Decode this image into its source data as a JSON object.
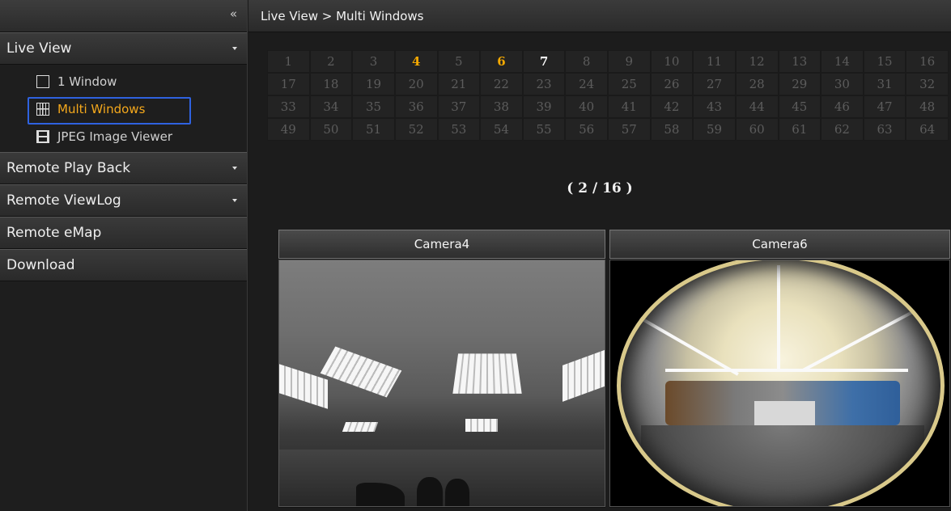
{
  "sidebar": {
    "collapse_icon": "«",
    "menus": [
      {
        "label": "Live View"
      },
      {
        "label": "Remote Play Back"
      },
      {
        "label": "Remote ViewLog"
      },
      {
        "label": "Remote eMap"
      },
      {
        "label": "Download"
      }
    ],
    "live_view_items": [
      {
        "label": "1 Window",
        "icon": "window-icon"
      },
      {
        "label": "Multi Windows",
        "icon": "grid-icon"
      },
      {
        "label": "JPEG Image Viewer",
        "icon": "film-icon"
      }
    ]
  },
  "header": {
    "breadcrumb": "Live View > Multi Windows"
  },
  "channels": {
    "numbers": [
      "1",
      "2",
      "3",
      "4",
      "5",
      "6",
      "7",
      "8",
      "9",
      "10",
      "11",
      "12",
      "13",
      "14",
      "15",
      "16",
      "17",
      "18",
      "19",
      "20",
      "21",
      "22",
      "23",
      "24",
      "25",
      "26",
      "27",
      "28",
      "29",
      "30",
      "31",
      "32",
      "33",
      "34",
      "35",
      "36",
      "37",
      "38",
      "39",
      "40",
      "41",
      "42",
      "43",
      "44",
      "45",
      "46",
      "47",
      "48",
      "49",
      "50",
      "51",
      "52",
      "53",
      "54",
      "55",
      "56",
      "57",
      "58",
      "59",
      "60",
      "61",
      "62",
      "63",
      "64"
    ],
    "active": [
      "4",
      "6"
    ],
    "selected": [
      "7"
    ]
  },
  "page_indicator": "( 2 / 16 )",
  "cameras": [
    {
      "name": "Camera4"
    },
    {
      "name": "Camera6"
    }
  ],
  "colors": {
    "active_channel": "#f5a900",
    "selection_outline": "#2f62e0",
    "selected_menu_text": "#f4a81c"
  }
}
